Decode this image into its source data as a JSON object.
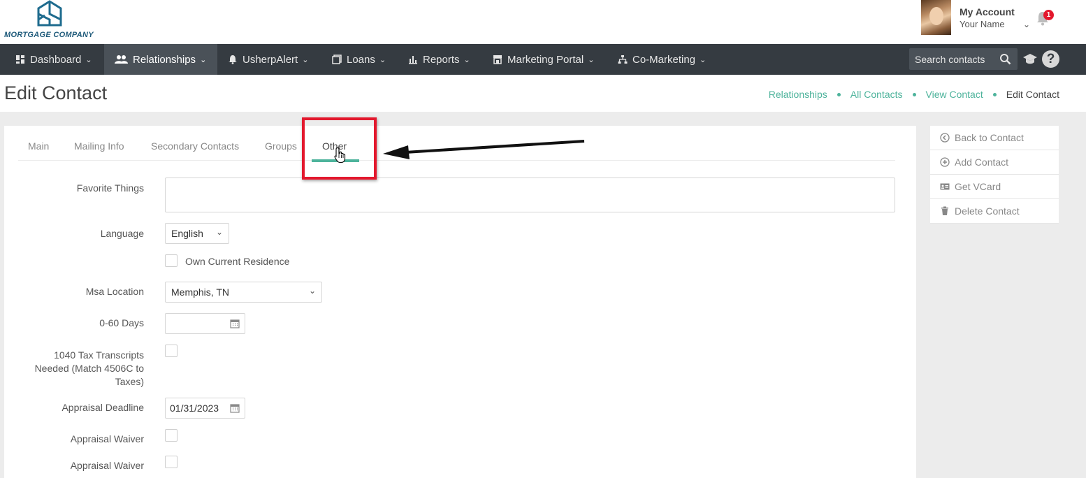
{
  "brand": {
    "logo_text": "MORTGAGE COMPANY"
  },
  "account": {
    "title": "My Account",
    "name": "Your Name",
    "notifications": "1"
  },
  "nav": {
    "items": [
      {
        "label": "Dashboard",
        "icon": "dashboard-icon"
      },
      {
        "label": "Relationships",
        "icon": "users-icon"
      },
      {
        "label": "UsherpAlert",
        "icon": "bell-icon"
      },
      {
        "label": "Loans",
        "icon": "stack-icon"
      },
      {
        "label": "Reports",
        "icon": "bar-chart-icon"
      },
      {
        "label": "Marketing Portal",
        "icon": "storefront-icon"
      },
      {
        "label": "Co-Marketing",
        "icon": "sitemap-icon"
      }
    ],
    "active": "Relationships",
    "search_placeholder": "Search contacts"
  },
  "page": {
    "title": "Edit Contact"
  },
  "breadcrumb": [
    "Relationships",
    "All Contacts",
    "View Contact",
    "Edit Contact"
  ],
  "tabs": [
    "Main",
    "Mailing Info",
    "Secondary Contacts",
    "Groups",
    "Other"
  ],
  "active_tab": "Other",
  "form": {
    "favorite_things": {
      "label": "Favorite Things",
      "value": ""
    },
    "language": {
      "label": "Language",
      "value": "English"
    },
    "own_residence": {
      "label": "Own Current Residence",
      "checked": false
    },
    "msa_location": {
      "label": "Msa Location",
      "value": "Memphis, TN"
    },
    "days_0_60": {
      "label": "0-60 Days",
      "value": ""
    },
    "tax_transcripts": {
      "label_line1": "1040 Tax Transcripts",
      "label_line2": "Needed (Match 4506C to",
      "label_line3": "Taxes)",
      "checked": false
    },
    "appraisal_deadline": {
      "label": "Appraisal Deadline",
      "value": "01/31/2023"
    },
    "appraisal_waiver_1": {
      "label": "Appraisal Waiver",
      "checked": false
    },
    "appraisal_waiver_2": {
      "label": "Appraisal Waiver",
      "checked": false
    }
  },
  "side_menu": [
    {
      "label": "Back to Contact",
      "icon": "circle-arrow-left-icon"
    },
    {
      "label": "Add Contact",
      "icon": "circle-plus-icon"
    },
    {
      "label": "Get VCard",
      "icon": "id-card-icon"
    },
    {
      "label": "Delete Contact",
      "icon": "trash-icon"
    }
  ],
  "colors": {
    "accent": "#4db39b",
    "nav_bg": "#353b41",
    "annotation": "#e3182d"
  }
}
